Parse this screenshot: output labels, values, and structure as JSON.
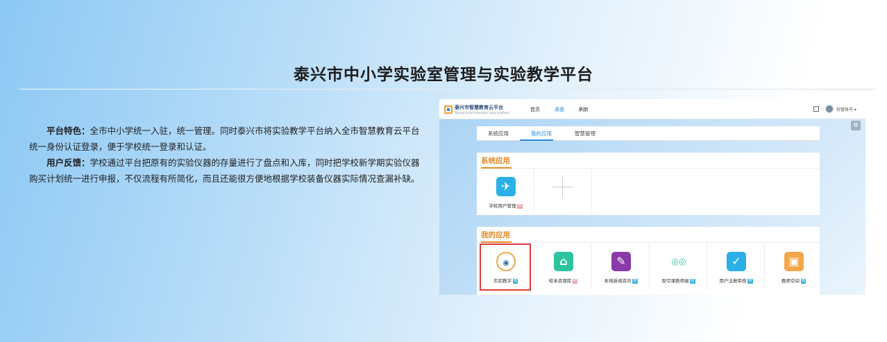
{
  "page": {
    "title": "泰兴市中小学实验室管理与实验教学平台"
  },
  "intro": {
    "feature_label": "平台特色：",
    "feature_text": "全市中小学统一入驻，统一管理。同时泰兴市将实验教学平台纳入全市智慧教育云平台统一身份认证登录，便于学校统一登录和认证。",
    "feedback_label": "用户反馈：",
    "feedback_text": "学校通过平台把原有的实验仪器的存量进行了盘点和入库，同时把学校新学期实验仪器购买计划统一进行申报，不仅流程有所简化，而且还能很方便地根据学校装备仪器实际情况查漏补缺。"
  },
  "screenshot": {
    "logo_text": "泰兴市智慧教育云平台",
    "logo_subtext": "Taixing Smart education cloud platform",
    "nav": [
      {
        "label": "首页",
        "active": false
      },
      {
        "label": "桌面",
        "active": true
      },
      {
        "label": "刷新",
        "active": false
      }
    ],
    "user_name": "校管账号 ▾",
    "tabs": [
      {
        "label": "系统应用",
        "active": false
      },
      {
        "label": "我的应用",
        "active": true
      },
      {
        "label": "智慧管理",
        "active": false
      }
    ],
    "system_apps": {
      "title": "系统应用",
      "items": [
        {
          "label": "学校用户管理",
          "badge": "校",
          "badge_color": "#f0a0a8",
          "icon": "bird-icon",
          "icon_color": "#2ab0e6"
        }
      ],
      "add_label": "+"
    },
    "my_apps": {
      "title": "我的应用",
      "items": [
        {
          "label": "实验教学",
          "badge": "校",
          "badge_color": "#3ab0e0",
          "icon": "lab-icon",
          "icon_color": "#ffffff",
          "glyph": "◉"
        },
        {
          "label": "校本资源库",
          "badge": "校",
          "badge_color": "#f0a0a8",
          "icon": "home-icon",
          "icon_color": "#2ec4a0",
          "glyph": "⌂"
        },
        {
          "label": "本地新闻资讯",
          "badge": "校",
          "badge_color": "#3ab0e0",
          "icon": "news-icon",
          "icon_color": "#8a3aa8",
          "glyph": "✎"
        },
        {
          "label": "智空课教师端",
          "badge": "校",
          "badge_color": "#3ab0e0",
          "icon": "owl-icon",
          "icon_color": "#ffffff",
          "glyph": "◎◎"
        },
        {
          "label": "用户注册审核",
          "badge": "校",
          "badge_color": "#3ab0e0",
          "icon": "bird-icon",
          "icon_color": "#2ab0e6",
          "glyph": "✓"
        },
        {
          "label": "教师空间",
          "badge": "校",
          "badge_color": "#3ab0e0",
          "icon": "portrait-icon",
          "icon_color": "#f2a84a",
          "glyph": "▣"
        }
      ]
    },
    "gear_glyph": "⚙"
  }
}
